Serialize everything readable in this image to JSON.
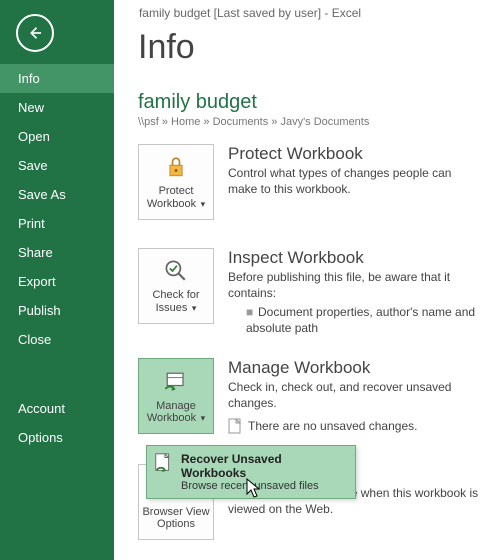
{
  "titlebar": "family budget [Last saved by user] - Excel",
  "sidebar": {
    "items": [
      "Info",
      "New",
      "Open",
      "Save",
      "Save As",
      "Print",
      "Share",
      "Export",
      "Publish",
      "Close"
    ],
    "bottom": [
      "Account",
      "Options"
    ]
  },
  "page": {
    "title": "Info",
    "docTitle": "family budget",
    "docPath": "\\\\psf » Home » Documents » Javy's Documents"
  },
  "sections": {
    "protect": {
      "tile": "Protect Workbook",
      "heading": "Protect Workbook",
      "desc": "Control what types of changes people can make to this workbook."
    },
    "inspect": {
      "tile": "Check for Issues",
      "heading": "Inspect Workbook",
      "lead": "Before publishing this file, be aware that it contains:",
      "item": "Document properties, author's name and absolute path"
    },
    "manage": {
      "tile": "Manage Workbook",
      "heading": "Manage Workbook",
      "desc": "Check in, check out, and recover unsaved changes.",
      "none": "There are no unsaved changes."
    },
    "browser": {
      "tile": "Browser View Options",
      "heading": "ptions",
      "desc": "Pick what users can see when this workbook is viewed on the Web."
    }
  },
  "popover": {
    "title": "Recover Unsaved Workbooks",
    "desc": "Browse recent unsaved files"
  }
}
